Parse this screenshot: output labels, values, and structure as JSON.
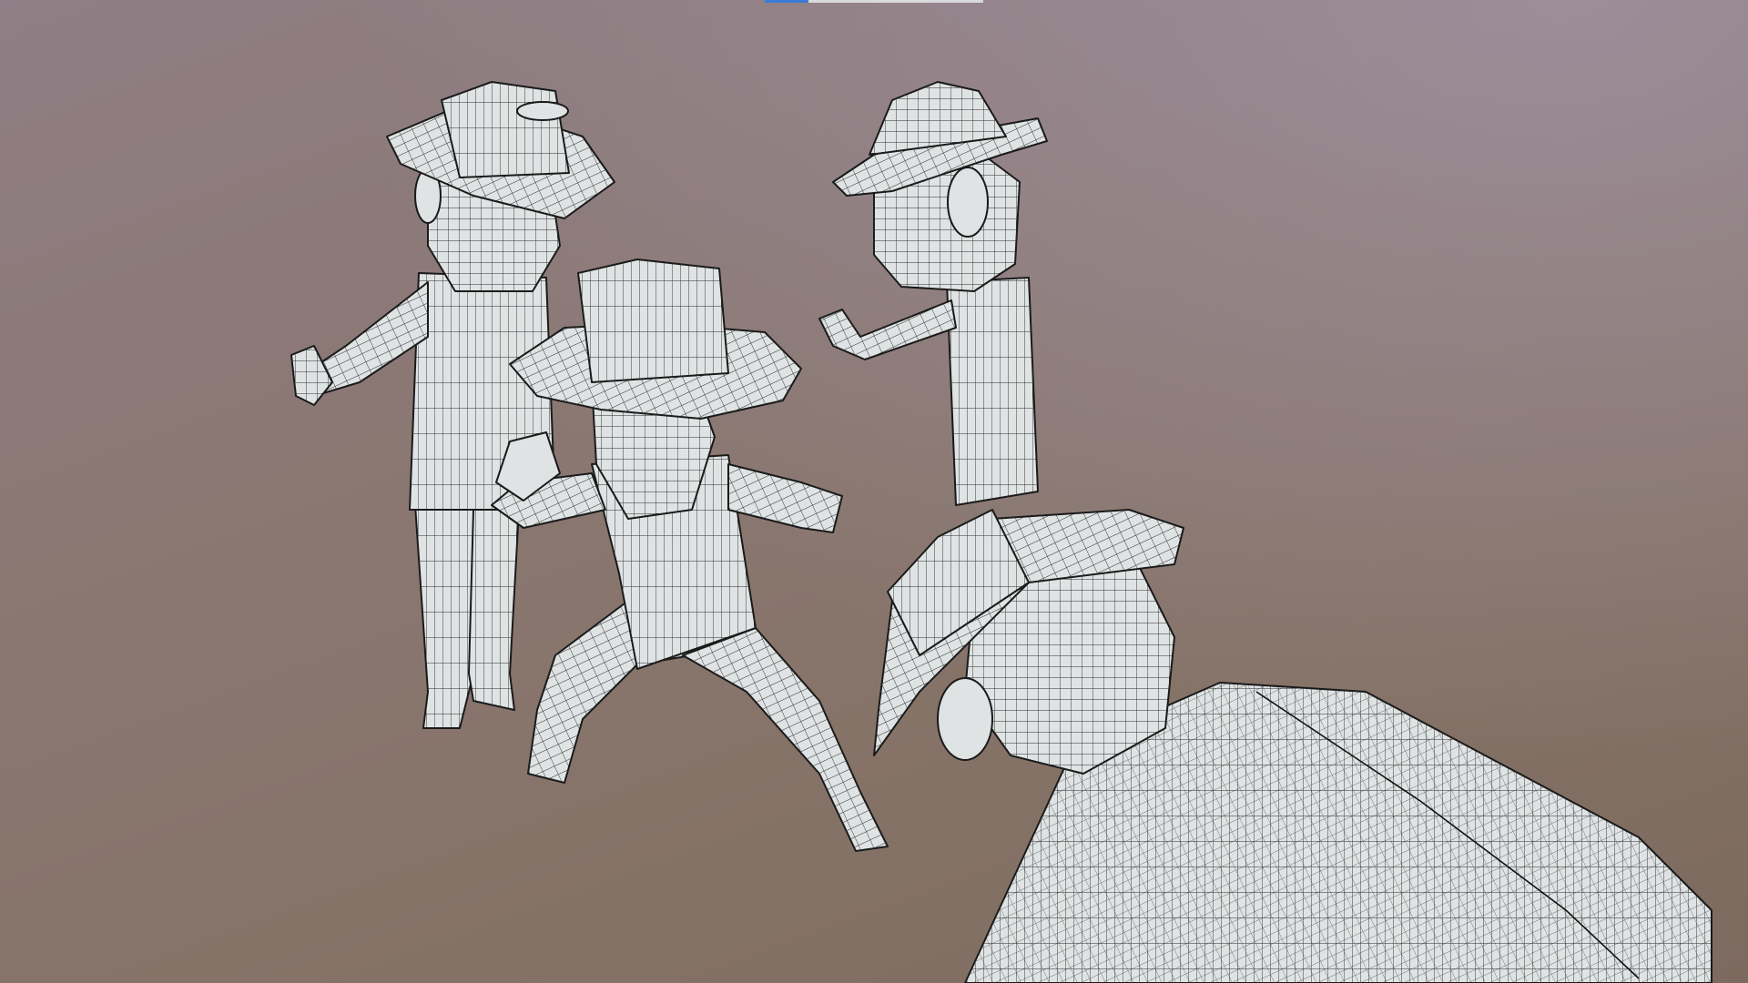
{
  "viewport": {
    "background_top": "#a99cae",
    "background_bottom": "#7f6a5f",
    "mesh_fill": "#dfe3e4",
    "wire_color": "#1a1a1a",
    "active_tab_color": "#3a7bd5"
  },
  "scene": {
    "render_mode": "wireframe-on-shaded",
    "objects": [
      "character-left",
      "character-center",
      "character-right",
      "character-foreground"
    ]
  }
}
